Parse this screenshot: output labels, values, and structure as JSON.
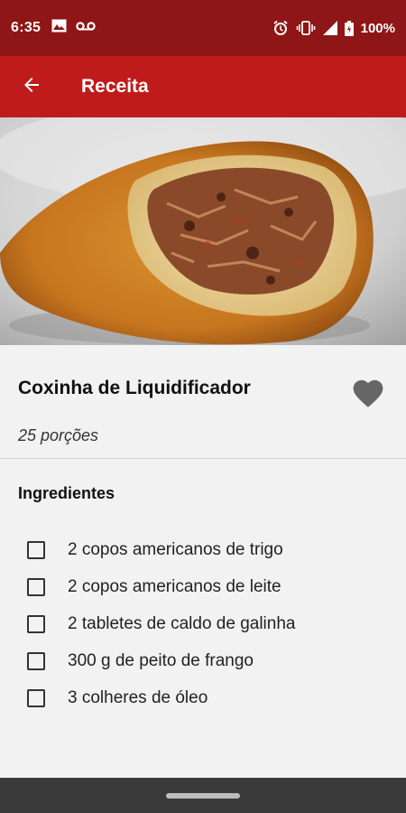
{
  "status_bar": {
    "time": "6:35",
    "left_icons": [
      "image-icon",
      "voicemail-icon"
    ],
    "right_icons": [
      "alarm-icon",
      "vibrate-icon",
      "signal-icon",
      "battery-icon"
    ],
    "battery": "100%"
  },
  "app_bar": {
    "back_icon": "arrow-back-icon",
    "title": "Receita",
    "color": "#c01b1b"
  },
  "recipe": {
    "title": "Coxinha de Liquidificador",
    "servings": "25 porções",
    "favorite_icon": "heart-icon"
  },
  "ingredients": {
    "heading": "Ingredientes",
    "items": [
      {
        "label": "2 copos americanos de trigo",
        "checked": false
      },
      {
        "label": "2 copos americanos de leite",
        "checked": false
      },
      {
        "label": "2 tabletes de caldo de galinha",
        "checked": false
      },
      {
        "label": "300 g de peito de frango",
        "checked": false
      },
      {
        "label": "3 colheres de óleo",
        "checked": false
      }
    ]
  },
  "colors": {
    "status_bar": "#8e1616",
    "app_bar": "#c01b1b",
    "background": "#f2f2f2",
    "heart": "#666666"
  }
}
